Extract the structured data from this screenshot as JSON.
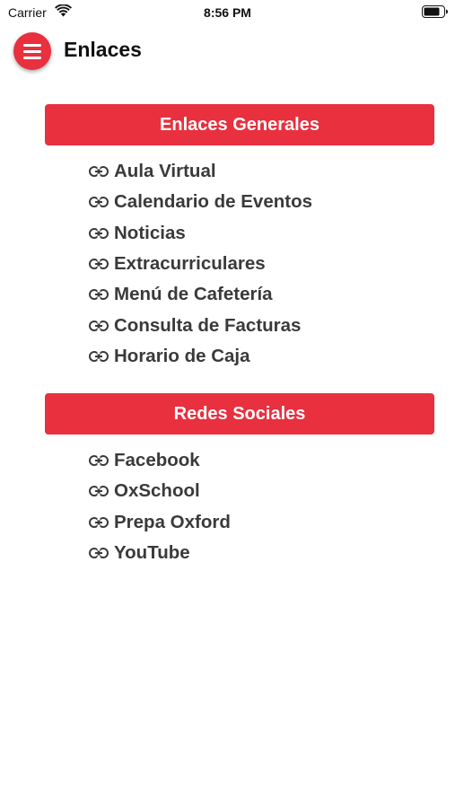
{
  "status_bar": {
    "carrier": "Carrier",
    "time": "8:56 PM",
    "icons": [
      "wifi-icon",
      "battery-icon"
    ]
  },
  "header": {
    "menu_icon": "hamburger-menu-icon",
    "title": "Enlaces"
  },
  "accent_color": "#e8303f",
  "sections": [
    {
      "title": "Enlaces Generales",
      "links": [
        "Aula Virtual",
        "Calendario de Eventos",
        "Noticias",
        "Extracurriculares",
        "Menú de Cafetería",
        "Consulta de Facturas",
        "Horario de Caja"
      ]
    },
    {
      "title": "Redes Sociales",
      "links": [
        "Facebook",
        "OxSchool",
        "Prepa Oxford",
        "YouTube"
      ]
    }
  ],
  "link_icon": "link-chain-icon"
}
